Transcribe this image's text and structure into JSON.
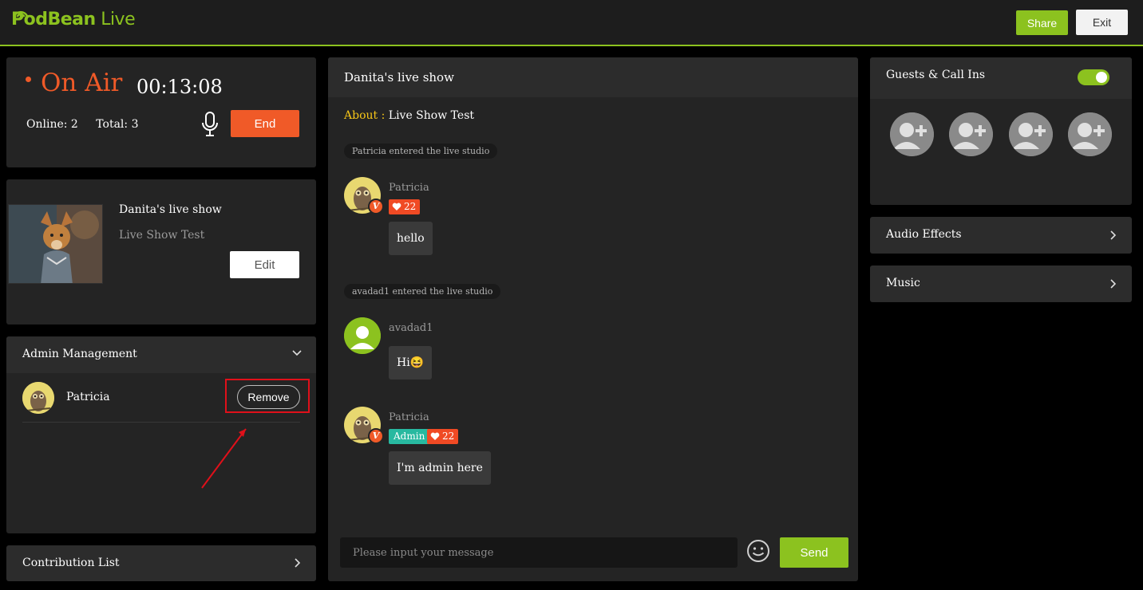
{
  "header": {
    "logo_brand": "PodBean",
    "logo_suffix": "Live",
    "share_label": "Share",
    "exit_label": "Exit",
    "accent_color": "#8cc21f"
  },
  "onair": {
    "status_label": "On Air",
    "timer": "00:13:08",
    "online_label": "Online: 2",
    "total_label": "Total: 3",
    "mic_icon": "microphone-icon",
    "end_label": "End",
    "status_color": "#f05a28"
  },
  "show": {
    "title": "Danita's live show",
    "description": "Live Show Test",
    "edit_label": "Edit"
  },
  "admin_management": {
    "title": "Admin Management",
    "admins": [
      {
        "name": "Patricia",
        "remove_label": "Remove"
      }
    ]
  },
  "contribution": {
    "title": "Contribution List"
  },
  "chat": {
    "title": "Danita's live show",
    "about_label": "About :",
    "about_value": "Live Show Test",
    "events": [
      {
        "text": "Patricia entered the live studio"
      },
      {
        "text": "avadad1 entered the live studio"
      }
    ],
    "messages": [
      {
        "name": "Patricia",
        "hearts": "22",
        "text": "hello",
        "verified": "V"
      },
      {
        "name": "avadad1",
        "text": "Hi😆"
      },
      {
        "name": "Patricia",
        "role": "Admin",
        "hearts": "22",
        "text": "I'm admin here",
        "verified": "V"
      }
    ],
    "input_placeholder": "Please input your message",
    "send_label": "Send"
  },
  "guests": {
    "title": "Guests & Call Ins",
    "enabled": true
  },
  "audio_effects": {
    "title": "Audio Effects"
  },
  "music": {
    "title": "Music"
  }
}
